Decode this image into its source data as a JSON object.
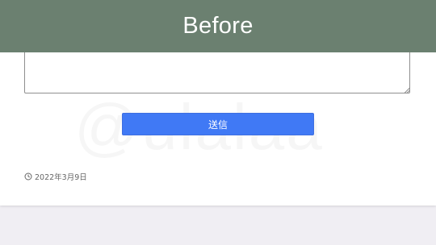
{
  "banner": {
    "title": "Before",
    "bg_color": "#6b8070"
  },
  "watermark": {
    "text": "@ulalaa"
  },
  "comment_form": {
    "textarea_value": "",
    "submit_label": "送信",
    "submit_color": "#4079f5"
  },
  "post_meta": {
    "date": "2022年3月9日",
    "date_icon": "clock-icon"
  }
}
